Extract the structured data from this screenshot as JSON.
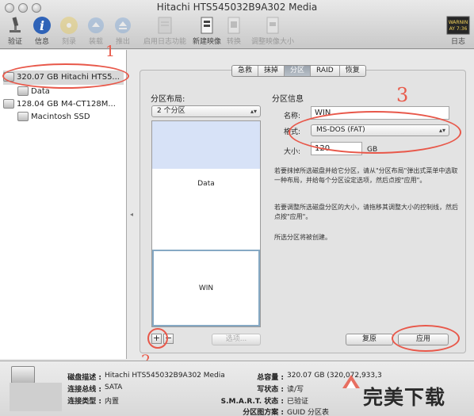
{
  "window": {
    "title": "Hitachi HTS545032B9A302 Media"
  },
  "toolbar": {
    "buttons": [
      {
        "label": "验证",
        "icon": "microscope-icon",
        "enabled": true
      },
      {
        "label": "信息",
        "icon": "info-icon",
        "enabled": true
      },
      {
        "label": "刻录",
        "icon": "burn-disc-icon",
        "enabled": false
      },
      {
        "label": "装载",
        "icon": "mount-icon",
        "enabled": false
      },
      {
        "label": "推出",
        "icon": "eject-icon",
        "enabled": false
      },
      {
        "label": "启用日志功能",
        "icon": "journal-icon",
        "enabled": false
      },
      {
        "label": "新建映像",
        "icon": "new-image-icon",
        "enabled": true
      },
      {
        "label": "转换",
        "icon": "convert-icon",
        "enabled": false
      },
      {
        "label": "调整映像大小",
        "icon": "resize-image-icon",
        "enabled": false
      }
    ],
    "log": {
      "label": "日志",
      "icon_text_1": "WARNIN",
      "icon_text_2": "AY 7:36"
    }
  },
  "sidebar": {
    "items": [
      {
        "label": "320.07 GB Hitachi HTS5...",
        "type": "disk",
        "selected": true
      },
      {
        "label": "Data",
        "type": "volume"
      },
      {
        "label": "128.04 GB M4-CT128M...",
        "type": "disk"
      },
      {
        "label": "Macintosh SSD",
        "type": "volume"
      }
    ]
  },
  "tabs": [
    {
      "label": "急救",
      "active": false
    },
    {
      "label": "抹掉",
      "active": false
    },
    {
      "label": "分区",
      "active": true
    },
    {
      "label": "RAID",
      "active": false
    },
    {
      "label": "恢复",
      "active": false
    }
  ],
  "partition": {
    "layout_label": "分区布局:",
    "layout_value": "2 个分区",
    "partitions": [
      {
        "name": "Data"
      },
      {
        "name": "WIN"
      }
    ],
    "add_symbol": "+",
    "remove_symbol": "−",
    "options_label": "选项...",
    "info_heading": "分区信息",
    "name_label": "名称:",
    "name_value": "WIN",
    "format_label": "格式:",
    "format_value": "MS-DOS (FAT)",
    "size_label": "大小:",
    "size_value": "120",
    "size_unit": "GB",
    "help1": "若要抹掉所选磁盘并给它分区，请从\"分区布局\"弹出式菜单中选取一种布局，并给每个分区设定选项，然后点按\"应用\"。",
    "help2": "若要调整所选磁盘分区的大小，请拖移其调整大小的控制线，然后点按\"应用\"。",
    "help3": "所选分区将被创建。",
    "revert_label": "复原",
    "apply_label": "应用"
  },
  "annotations": {
    "n1": "1",
    "n2": "2",
    "n3": "3",
    "color": "#e8584a"
  },
  "bottom": {
    "left": [
      {
        "key": "磁盘描述 :",
        "value": "Hitachi HTS545032B9A302 Media"
      },
      {
        "key": "连接总线 :",
        "value": "SATA"
      },
      {
        "key": "连接类型 :",
        "value": "内置"
      }
    ],
    "right": [
      {
        "key": "总容量 :",
        "value": "320.07 GB (320,072,933,3"
      },
      {
        "key": "写状态 :",
        "value": "读/写"
      },
      {
        "key": "S.M.A.R.T. 状态 :",
        "value": "已验证"
      },
      {
        "key": "分区图方案 :",
        "value": "GUID 分区表"
      }
    ]
  },
  "watermark": {
    "text": "完美下载"
  }
}
